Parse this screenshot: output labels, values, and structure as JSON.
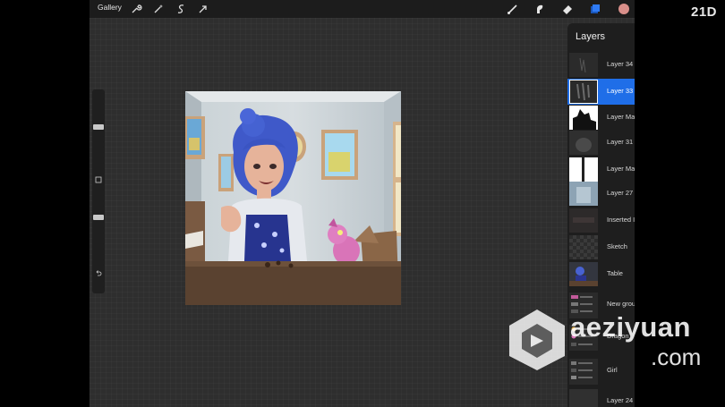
{
  "topbar": {
    "gallery_label": "Gallery",
    "left_tools": [
      "wrench-icon",
      "adjustments-magic-icon",
      "selection-s-icon",
      "transform-arrow-icon"
    ],
    "right_tools": [
      "brush-icon",
      "smudge-icon",
      "eraser-icon",
      "layers-icon",
      "color-swatch"
    ],
    "color_swatch": "#d98f8a",
    "layers_icon_color": "#2f7bf5"
  },
  "brand": {
    "logo": "21D"
  },
  "panel": {
    "title": "Layers",
    "add_label": "+",
    "layers": [
      {
        "name": "Layer 34",
        "mode": "N",
        "visible": true,
        "active": false
      },
      {
        "name": "Layer 33",
        "mode": "O",
        "visible": true,
        "active": true
      },
      {
        "name": "Layer Mask",
        "mode": "",
        "visible": true,
        "active": false
      },
      {
        "name": "Layer 31",
        "mode": "O",
        "visible": true,
        "active": false
      },
      {
        "name": "Layer Mask",
        "mode": "",
        "visible": true,
        "active": false
      },
      {
        "name": "Layer 27",
        "mode": "M",
        "visible": true,
        "active": false
      },
      {
        "name": "Inserted Image",
        "mode": "M",
        "visible": true,
        "active": false
      },
      {
        "name": "Sketch",
        "mode": "M",
        "visible": true,
        "active": false
      },
      {
        "name": "Table",
        "mode": "N",
        "visible": true,
        "active": false
      },
      {
        "name": "New group",
        "mode": ">",
        "visible": true,
        "active": false
      },
      {
        "name": "Dragon",
        "mode": "",
        "visible": true,
        "active": false
      },
      {
        "name": "Girl",
        "mode": ">",
        "visible": true,
        "active": false
      },
      {
        "name": "Layer 24",
        "mode": "M",
        "visible": true,
        "active": false
      }
    ]
  },
  "watermark": {
    "text": "aeziyuan",
    "domain": ".com"
  },
  "colors": {
    "accent": "#1f6ee8",
    "panel_bg": "#1e1e1e",
    "canvas_bg": "#2e2e2e"
  }
}
